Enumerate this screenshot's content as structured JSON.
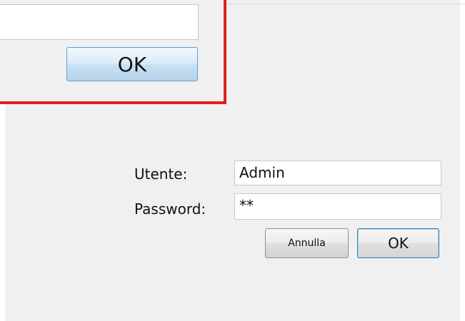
{
  "background_dialog": {
    "input_value": "",
    "ok_label": "OK",
    "highlight_color": "#e02020"
  },
  "login": {
    "user_label": "Utente:",
    "user_value": "Admin",
    "password_label": "Password:",
    "password_value": "**",
    "cancel_label": "Annulla",
    "ok_label": "OK"
  }
}
